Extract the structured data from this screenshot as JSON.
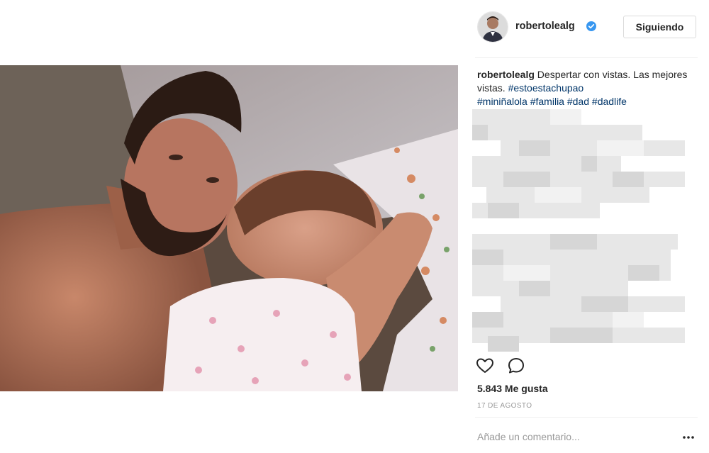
{
  "post": {
    "username": "robertolealg",
    "follow_label": "Siguiendo",
    "caption_user": "robertolealg",
    "caption_text": " Despertar con vistas. Las mejores vistas. ",
    "hashtags": [
      "#estoestachupao",
      "#miniñalola",
      "#familia",
      "#dad",
      "#dadlife"
    ],
    "likes": "5.843 Me gusta",
    "date": "17 DE AGOSTO",
    "comment_placeholder": "Añade un comentario...",
    "more_options_label": "•••"
  },
  "icons": {
    "verified": "verified-badge-icon",
    "like": "heart-icon",
    "comment": "comment-bubble-icon",
    "more": "more-options-icon"
  },
  "colors": {
    "hashtag": "#003569",
    "verified": "#3897f0",
    "muted": "#999999",
    "text": "#262626",
    "border": "#dbdbdb"
  }
}
